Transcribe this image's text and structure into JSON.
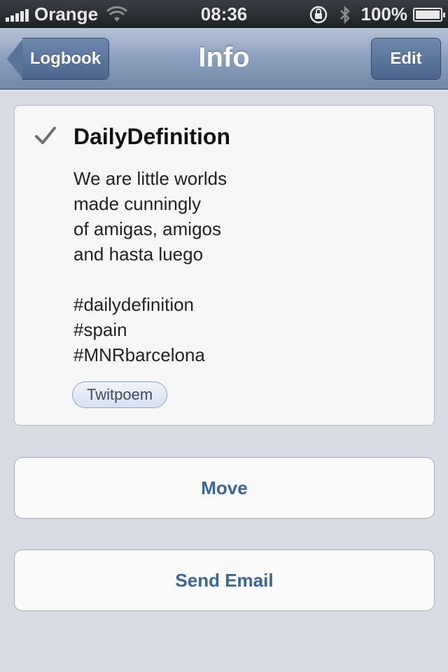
{
  "status_bar": {
    "carrier": "Orange",
    "time": "08:36",
    "battery": "100%",
    "battery_level": 1.0,
    "icons": [
      "signal-icon",
      "wifi-icon",
      "rotation-lock-icon",
      "bluetooth-icon",
      "battery-icon"
    ]
  },
  "nav": {
    "title": "Info",
    "back_label": "Logbook",
    "edit_label": "Edit"
  },
  "entry": {
    "checked": true,
    "title": "DailyDefinition",
    "lines": [
      "We are little worlds",
      "made cunningly",
      "of amigas, amigos",
      "and hasta luego",
      "",
      "#dailydefinition",
      "#spain",
      "#MNRbarcelona"
    ],
    "tag": "Twitpoem"
  },
  "actions": {
    "move_label": "Move",
    "send_email_label": "Send Email"
  },
  "colors": {
    "nav_gradient_top": "#b6c3d6",
    "nav_gradient_bottom": "#6f87a8",
    "button_text": "#3d6592",
    "background": "#d8dbe2"
  }
}
